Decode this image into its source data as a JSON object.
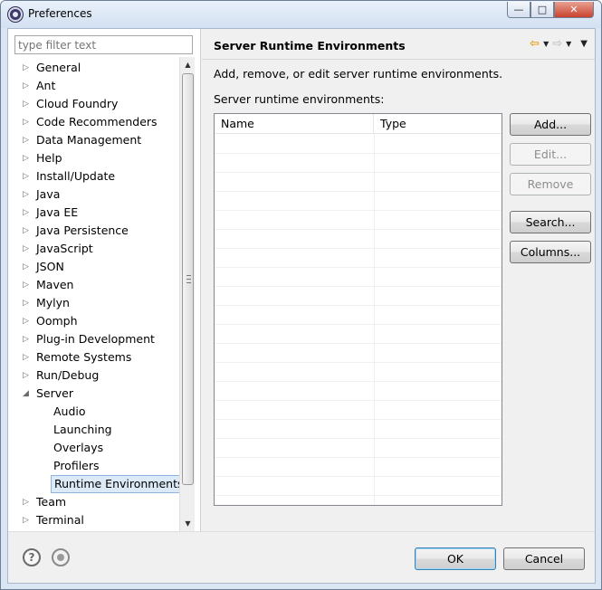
{
  "window": {
    "title": "Preferences",
    "buttons": {
      "minimize": "—",
      "maximize": "□",
      "close": "✕"
    }
  },
  "filter": {
    "placeholder": "type filter text"
  },
  "tree": [
    {
      "label": "General",
      "arrow": "▷",
      "child": false,
      "selected": false
    },
    {
      "label": "Ant",
      "arrow": "▷",
      "child": false,
      "selected": false
    },
    {
      "label": "Cloud Foundry",
      "arrow": "▷",
      "child": false,
      "selected": false
    },
    {
      "label": "Code Recommenders",
      "arrow": "▷",
      "child": false,
      "selected": false
    },
    {
      "label": "Data Management",
      "arrow": "▷",
      "child": false,
      "selected": false
    },
    {
      "label": "Help",
      "arrow": "▷",
      "child": false,
      "selected": false
    },
    {
      "label": "Install/Update",
      "arrow": "▷",
      "child": false,
      "selected": false
    },
    {
      "label": "Java",
      "arrow": "▷",
      "child": false,
      "selected": false
    },
    {
      "label": "Java EE",
      "arrow": "▷",
      "child": false,
      "selected": false
    },
    {
      "label": "Java Persistence",
      "arrow": "▷",
      "child": false,
      "selected": false
    },
    {
      "label": "JavaScript",
      "arrow": "▷",
      "child": false,
      "selected": false
    },
    {
      "label": "JSON",
      "arrow": "▷",
      "child": false,
      "selected": false
    },
    {
      "label": "Maven",
      "arrow": "▷",
      "child": false,
      "selected": false
    },
    {
      "label": "Mylyn",
      "arrow": "▷",
      "child": false,
      "selected": false
    },
    {
      "label": "Oomph",
      "arrow": "▷",
      "child": false,
      "selected": false
    },
    {
      "label": "Plug-in Development",
      "arrow": "▷",
      "child": false,
      "selected": false
    },
    {
      "label": "Remote Systems",
      "arrow": "▷",
      "child": false,
      "selected": false
    },
    {
      "label": "Run/Debug",
      "arrow": "▷",
      "child": false,
      "selected": false
    },
    {
      "label": "Server",
      "arrow": "◢",
      "child": false,
      "selected": false
    },
    {
      "label": "Audio",
      "arrow": "",
      "child": true,
      "selected": false
    },
    {
      "label": "Launching",
      "arrow": "",
      "child": true,
      "selected": false
    },
    {
      "label": "Overlays",
      "arrow": "",
      "child": true,
      "selected": false
    },
    {
      "label": "Profilers",
      "arrow": "",
      "child": true,
      "selected": false
    },
    {
      "label": "Runtime Environments",
      "arrow": "",
      "child": true,
      "selected": true
    },
    {
      "label": "Team",
      "arrow": "▷",
      "child": false,
      "selected": false
    },
    {
      "label": "Terminal",
      "arrow": "▷",
      "child": false,
      "selected": false
    }
  ],
  "page": {
    "title": "Server Runtime Environments",
    "description": "Add, remove, or edit server runtime environments.",
    "table_label": "Server runtime environments:",
    "columns": [
      "Name",
      "Type"
    ],
    "rows": []
  },
  "nav": {
    "back": "⇦",
    "forward": "⇨",
    "dropdown": "▼",
    "menu": "▼"
  },
  "buttons": {
    "add": "Add...",
    "edit": "Edit...",
    "remove": "Remove",
    "search": "Search...",
    "columns": "Columns..."
  },
  "bottom": {
    "help": "?",
    "ok": "OK",
    "cancel": "Cancel"
  }
}
